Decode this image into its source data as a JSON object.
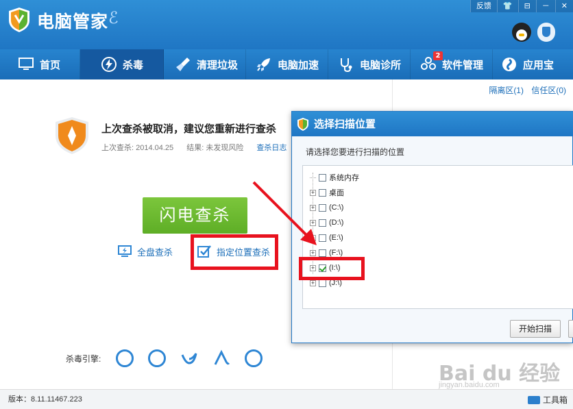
{
  "app": {
    "title": "电脑管家",
    "title_swash": "ℰ"
  },
  "top_controls": [
    "反馈",
    "👕",
    "⊟",
    "－",
    "✕"
  ],
  "nav": [
    {
      "label": "首页",
      "icon": "monitor-icon"
    },
    {
      "label": "杀毒",
      "icon": "lightning-icon",
      "active": true
    },
    {
      "label": "清理垃圾",
      "icon": "broom-icon"
    },
    {
      "label": "电脑加速",
      "icon": "rocket-icon"
    },
    {
      "label": "电脑诊所",
      "icon": "stethoscope-icon"
    },
    {
      "label": "软件管理",
      "icon": "apps-icon",
      "badge": "2"
    },
    {
      "label": "应用宝",
      "icon": "app-store-icon"
    }
  ],
  "side_links": {
    "quarantine": "隔离区(1)",
    "trust": "信任区(0)"
  },
  "status": {
    "headline": "上次查杀被取消，建议您重新进行查杀",
    "last_scan": "上次查杀: 2014.04.25",
    "result": "结果: 未发现风险",
    "log_link": "查杀日志"
  },
  "actions": {
    "flash_scan": "闪电查杀",
    "full_scan": "全盘查杀",
    "custom_scan": "指定位置查杀"
  },
  "engines": {
    "label": "杀毒引擎:"
  },
  "footer": {
    "version": "版本：8.11.11467.223",
    "toolbox": "工具箱"
  },
  "dialog": {
    "title": "选择扫描位置",
    "subtitle": "请选择您要进行扫描的位置",
    "tree": [
      {
        "label": "系统内存",
        "expandable": false,
        "checked": false
      },
      {
        "label": "桌面",
        "expandable": true,
        "checked": false
      },
      {
        "label": "(C:\\)",
        "expandable": true,
        "checked": false
      },
      {
        "label": "(D:\\)",
        "expandable": true,
        "checked": false
      },
      {
        "label": "(E:\\)",
        "expandable": true,
        "checked": false
      },
      {
        "label": "(F:\\)",
        "expandable": true,
        "checked": false
      },
      {
        "label": "(I:\\)",
        "expandable": true,
        "checked": true
      },
      {
        "label": "(J:\\)",
        "expandable": true,
        "checked": false
      }
    ],
    "start_button": "开始扫描"
  },
  "watermark": {
    "text": "Bai du 经验",
    "url": "jingyan.baidu.com"
  },
  "colors": {
    "brand_blue": "#1f76c4",
    "active_nav": "#1559a0",
    "green_button": "#6bb82f",
    "highlight_red": "#e8121e"
  }
}
